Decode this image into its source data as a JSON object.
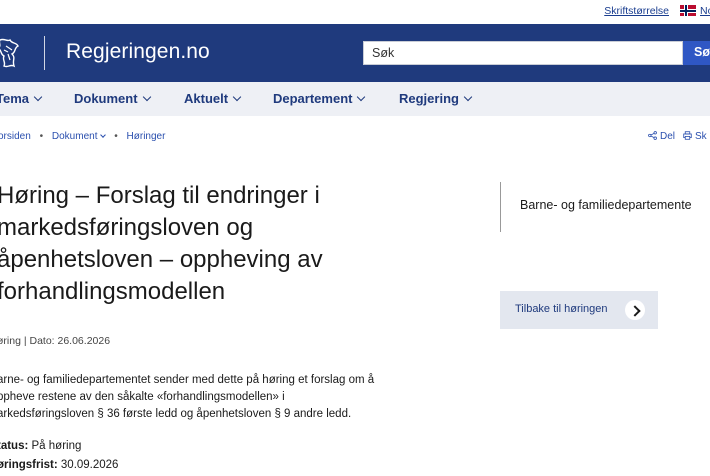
{
  "topbar": {
    "font_size_label": "Skriftstørrelse",
    "language_label": "No"
  },
  "header": {
    "site_title": "Regjeringen.no",
    "search_placeholder": "Søk",
    "search_button": "Sø",
    "background_color": "#1f3a7d"
  },
  "nav": {
    "items": [
      {
        "label": "Tema"
      },
      {
        "label": "Dokument"
      },
      {
        "label": "Aktuelt"
      },
      {
        "label": "Departement"
      },
      {
        "label": "Regjering"
      }
    ]
  },
  "breadcrumb": {
    "items": [
      "orsiden",
      "Dokument",
      "Høringer"
    ]
  },
  "share": {
    "share_label": "Del",
    "print_label": "Sk"
  },
  "article": {
    "title_lines": [
      "Høring – Forslag til endringer i",
      "markedsføringsloven og",
      "åpenhetsloven – oppheving av",
      "forhandlingsmodellen"
    ],
    "meta": "øring | Dato: 26.06.2026",
    "lead_lines": [
      "arne- og familiedepartementet sender med dette på høring et forslag om å",
      "ppheve restene av den såkalte «forhandlingsmodellen» i",
      "arkedsføringsloven § 36 første ledd og åpenhetsloven § 9 andre ledd."
    ],
    "status_label": "tatus:",
    "status_value": " På høring",
    "deadline_label": "øringsfrist:",
    "deadline_value": " 30.09.2026"
  },
  "aside": {
    "department": "Barne- og familiedepartemente",
    "back_label": "Tilbake til høringen"
  }
}
